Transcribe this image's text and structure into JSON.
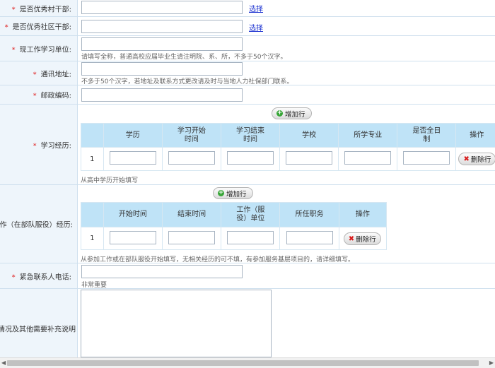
{
  "rows": {
    "village_cadre": {
      "label": "是否优秀村干部:",
      "required": "*",
      "select_link": "选择"
    },
    "community_cadre": {
      "label": "是否优秀社区干部:",
      "required": "*",
      "select_link": "选择"
    },
    "workplace": {
      "label": "现工作学习单位:",
      "required": "*",
      "hint": "请填写全称，普通高校应届毕业生请注明院、系、所，不多于50个汉字。"
    },
    "address": {
      "label": "通讯地址:",
      "required": "*",
      "hint": "不多于50个汉字，若地址及联系方式更改请及时与当地人力社保部门联系。"
    },
    "postcode": {
      "label": "邮政编码:",
      "required": "*"
    },
    "education": {
      "label": "学习经历:",
      "required": "*",
      "add_button": "增加行",
      "columns": [
        "",
        "学历",
        "学习开始时间",
        "学习结束时间",
        "学校",
        "所学专业",
        "是否全日制",
        "操作"
      ],
      "rows": [
        {
          "index": "1",
          "delete_button": "删除行"
        }
      ],
      "hint": "从高中学历开始填写"
    },
    "work": {
      "label": "工作（在部队服役）经历:",
      "add_button": "增加行",
      "columns": [
        "",
        "开始时间",
        "结束时间",
        "工作（服役）单位",
        "所任职务",
        "操作"
      ],
      "rows": [
        {
          "index": "1",
          "delete_button": "删除行"
        }
      ],
      "hint": "从参加工作或在部队服役开始填写，无相关经历的可不填，有参加服务基层项目的，请详细填写。"
    },
    "emergency_phone": {
      "label": "紧急联系人电话:",
      "required": "*",
      "hint": "非常重要"
    },
    "awards": {
      "label": "获奖情况及其他需要补充说明"
    }
  },
  "icons": {
    "add": "plus-circle-icon",
    "delete": "x-icon"
  }
}
